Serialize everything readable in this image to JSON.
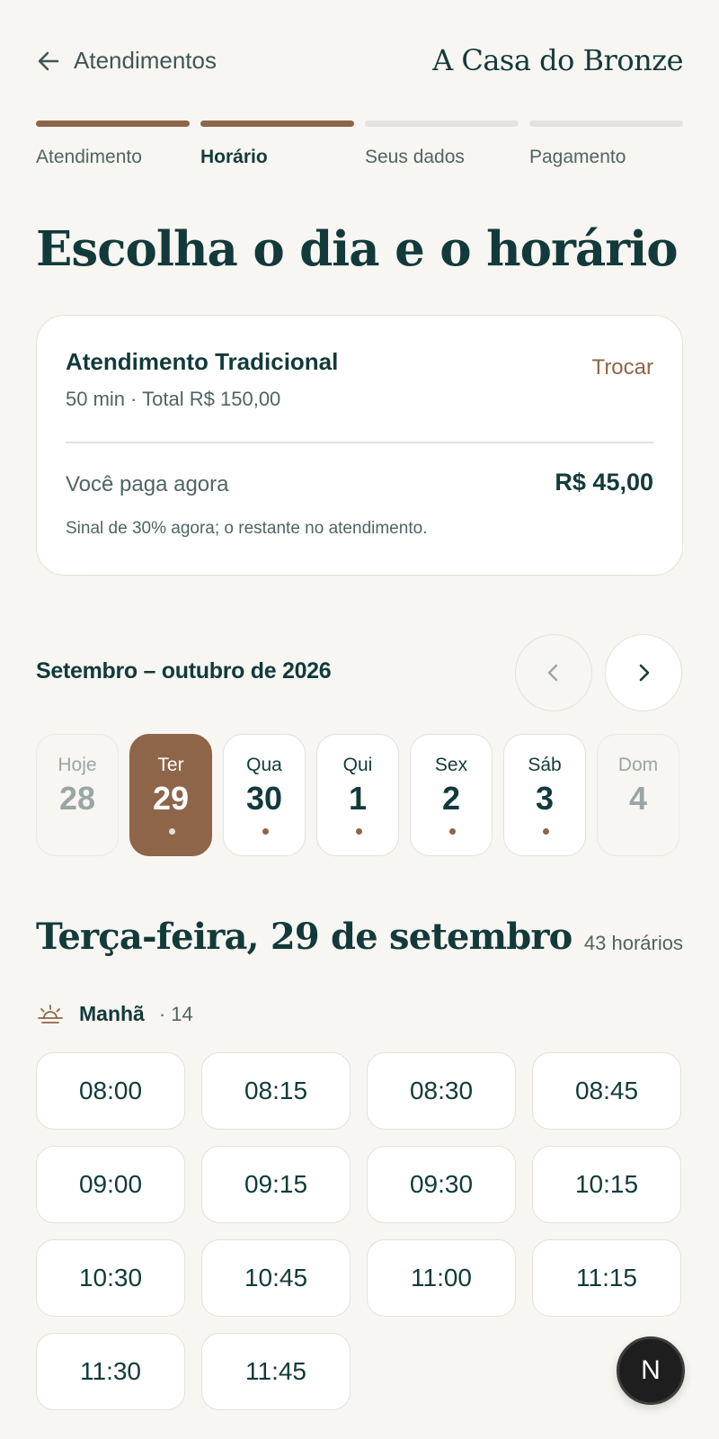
{
  "header": {
    "back_label": "Atendimentos",
    "brand": "A Casa do Bronze"
  },
  "steps": [
    {
      "label": "Atendimento",
      "done": true,
      "active": false
    },
    {
      "label": "Horário",
      "done": true,
      "active": true
    },
    {
      "label": "Seus dados",
      "done": false,
      "active": false
    },
    {
      "label": "Pagamento",
      "done": false,
      "active": false
    }
  ],
  "page_title": "Escolha o dia e o horário",
  "summary": {
    "service_name": "Atendimento Tradicional",
    "service_meta": "50 min · Total R$ 150,00",
    "swap_label": "Trocar",
    "pay_now_label": "Você paga agora",
    "pay_now_value": "R$ 45,00",
    "note": "Sinal de 30% agora; o restante no atendimento."
  },
  "calendar": {
    "month_label": "Setembro – outubro de 2026",
    "prev_icon": "chevron-left-icon",
    "next_icon": "chevron-right-icon",
    "days": [
      {
        "weekday": "Hoje",
        "day": "28",
        "state": "disabled",
        "available": false
      },
      {
        "weekday": "Ter",
        "day": "29",
        "state": "selected",
        "available": true
      },
      {
        "weekday": "Qua",
        "day": "30",
        "state": "normal",
        "available": true
      },
      {
        "weekday": "Qui",
        "day": "1",
        "state": "normal",
        "available": true
      },
      {
        "weekday": "Sex",
        "day": "2",
        "state": "normal",
        "available": true
      },
      {
        "weekday": "Sáb",
        "day": "3",
        "state": "normal",
        "available": true
      },
      {
        "weekday": "Dom",
        "day": "4",
        "state": "disabled",
        "available": false
      }
    ]
  },
  "selected_day": {
    "heading": "Terça-feira, 29 de setembro",
    "count": "43 horários"
  },
  "period": {
    "icon": "sunrise-icon",
    "name": "Manhã",
    "count": "· 14"
  },
  "slots": [
    "08:00",
    "08:15",
    "08:30",
    "08:45",
    "09:00",
    "09:15",
    "09:30",
    "10:15",
    "10:30",
    "10:45",
    "11:00",
    "11:15",
    "11:30",
    "11:45"
  ],
  "fab": {
    "label": "N"
  },
  "colors": {
    "background": "#f8f6f2",
    "primary_text": "#123a3a",
    "accent_brown": "#8e6548"
  }
}
